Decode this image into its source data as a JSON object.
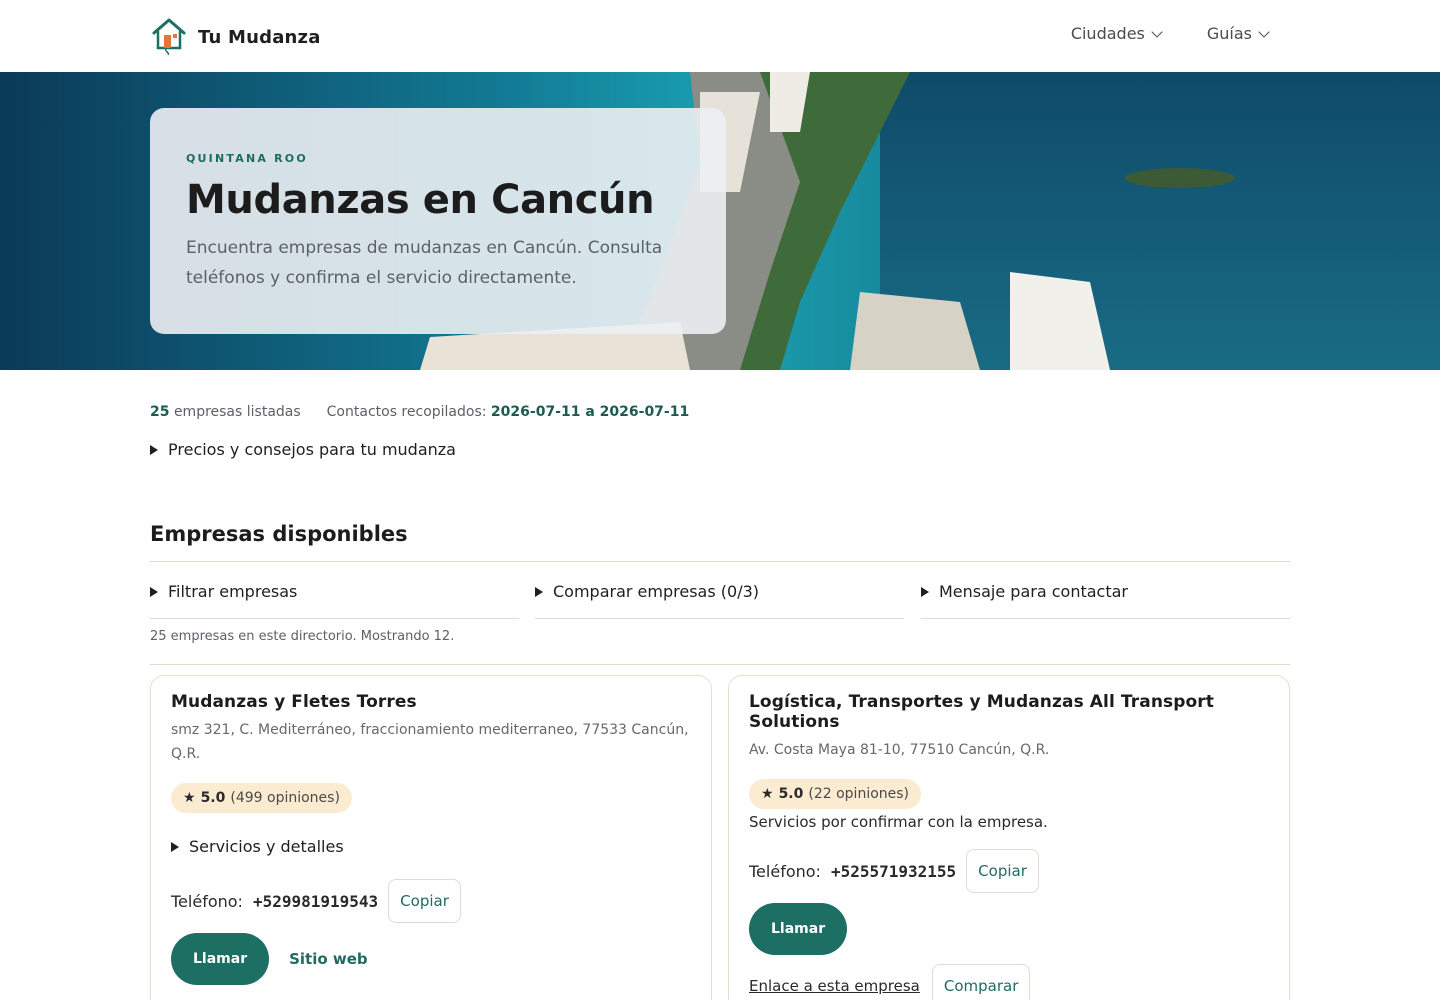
{
  "header": {
    "brand": "Tu Mudanza",
    "nav": [
      {
        "label": "Ciudades"
      },
      {
        "label": "Guías"
      }
    ]
  },
  "hero": {
    "eyebrow": "QUINTANA ROO",
    "title": "Mudanzas en Cancún",
    "subtitle": "Encuentra empresas de mudanzas en Cancún. Consulta teléfonos y confirma el servicio directamente."
  },
  "stats": {
    "count": "25",
    "count_label": "empresas listadas",
    "contacts_label": "Contactos recopilados:",
    "contacts_range": "2026-07-11 a 2026-07-11"
  },
  "tips_summary": "Precios y consejos para tu mudanza",
  "section_title": "Empresas disponibles",
  "tools": [
    {
      "label": "Filtrar empresas"
    },
    {
      "label": "Comparar empresas (0/3)"
    },
    {
      "label": "Mensaje para contactar"
    }
  ],
  "count_note": "25 empresas en este directorio. Mostrando 12.",
  "cards": [
    {
      "name": "Mudanzas y Fletes Torres",
      "address": "smz 321, C. Mediterráneo, fraccionamiento mediterraneo, 77533 Cancún, Q.R.",
      "rating": "5.0",
      "reviews": "(499 opiniones)",
      "services_summary": "Servicios y detalles",
      "phone_label": "Teléfono:",
      "phone": "+529981919543",
      "copy_label": "Copiar",
      "call_label": "Llamar",
      "website_label": "Sitio web"
    },
    {
      "name": "Logística, Transportes y Mudanzas All Transport Solutions",
      "address": "Av. Costa Maya 81-10, 77510 Cancún, Q.R.",
      "rating": "5.0",
      "reviews": "(22 opiniones)",
      "services_text": "Servicios por confirmar con la empresa.",
      "phone_label": "Teléfono:",
      "phone": "+525571932155",
      "copy_label": "Copiar",
      "call_label": "Llamar",
      "link_label": "Enlace a esta empresa",
      "compare_label": "Comparar"
    }
  ],
  "colors": {
    "accent": "#1d6e63",
    "rating_bg": "#fbebd0",
    "divider": "#e3dccb"
  }
}
